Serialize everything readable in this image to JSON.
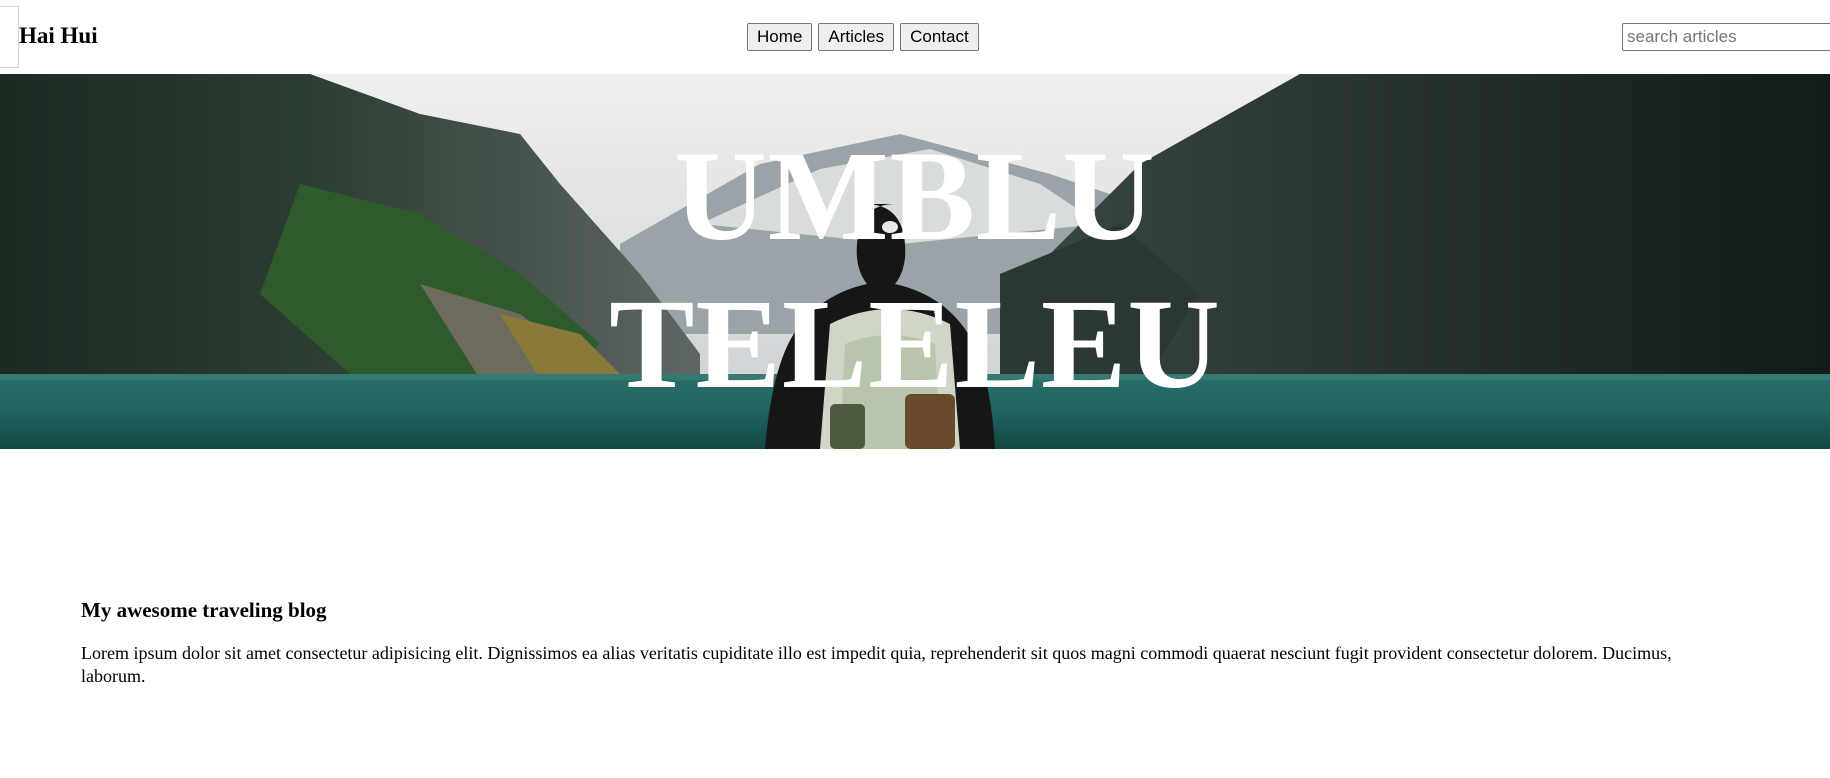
{
  "header": {
    "logo": "Hai Hui",
    "nav": [
      {
        "label": "Home"
      },
      {
        "label": "Articles"
      },
      {
        "label": "Contact"
      }
    ],
    "search_placeholder": "search articles"
  },
  "hero": {
    "line1": "UMBLU",
    "line2": "TELELEU"
  },
  "article": {
    "title": "My awesome traveling blog",
    "body": "Lorem ipsum dolor sit amet consectetur adipisicing elit. Dignissimos ea alias veritatis cupiditate illo est impedit quia, reprehenderit sit quos magni commodi quaerat nesciunt fugit provident consectetur dolorem. Ducimus, laborum."
  },
  "colors": {
    "hero_text": "#ffffff",
    "lake": "#1d6a64",
    "forest": "#14231c"
  }
}
